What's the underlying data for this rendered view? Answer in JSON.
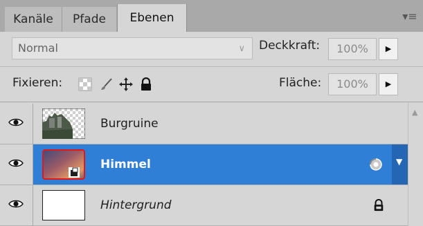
{
  "tabs": [
    {
      "label": "Kanäle",
      "active": false
    },
    {
      "label": "Pfade",
      "active": false
    },
    {
      "label": "Ebenen",
      "active": true
    }
  ],
  "panel_menu_icon": "panel-menu-icon",
  "blend_mode": {
    "value": "Normal"
  },
  "opacity": {
    "label": "Deckkraft:",
    "value": "100%"
  },
  "lock": {
    "label": "Fixieren:",
    "icons": [
      "lock-transparency-icon",
      "lock-image-icon",
      "lock-position-icon",
      "lock-all-icon"
    ]
  },
  "fill": {
    "label": "Fläche:",
    "value": "100%"
  },
  "layers": [
    {
      "name": "Burgruine",
      "selected": false,
      "italic": false
    },
    {
      "name": "Himmel",
      "selected": true,
      "italic": false,
      "smart_object": true
    },
    {
      "name": "Hintergrund",
      "selected": false,
      "italic": true,
      "locked": true
    }
  ],
  "colors": {
    "selection": "#2f7fd6",
    "panel": "#d6d6d6",
    "tabbar": "#a9a9a9"
  }
}
